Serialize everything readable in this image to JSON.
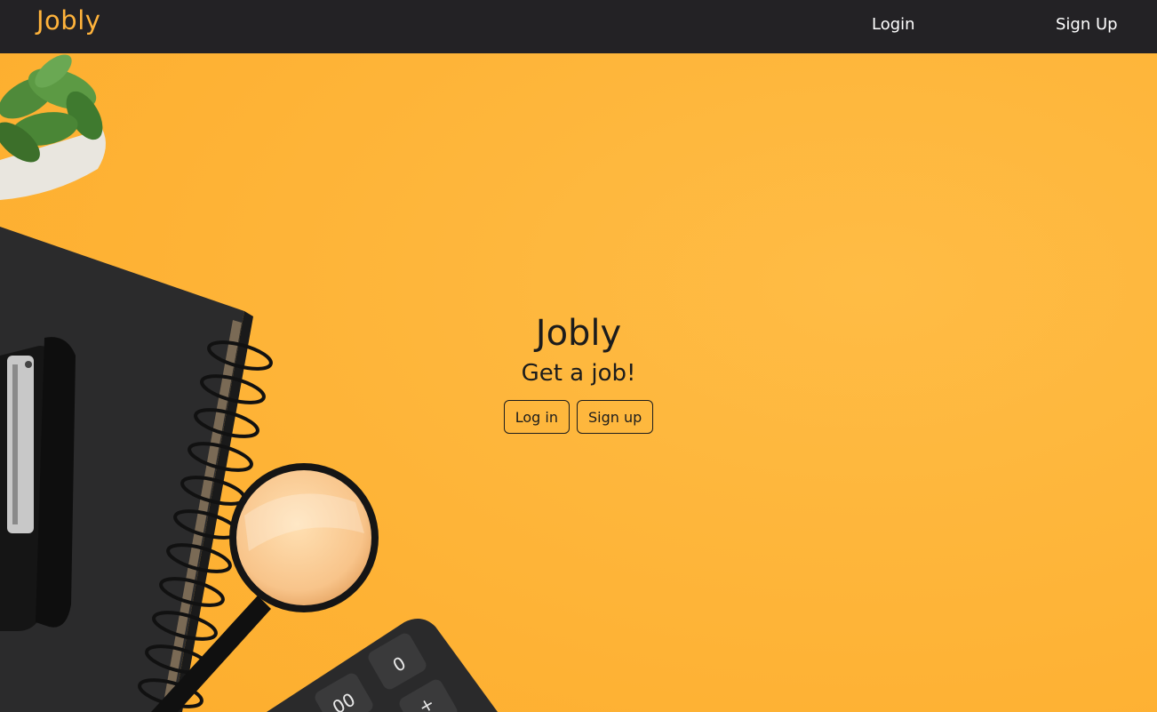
{
  "navbar": {
    "brand": "Jobly",
    "links": {
      "login": "Login",
      "signup": "Sign Up"
    }
  },
  "hero": {
    "title": "Jobly",
    "subtitle": "Get a job!",
    "buttons": {
      "login": "Log in",
      "signup": "Sign up"
    }
  },
  "colors": {
    "accent": "#ffb33b",
    "navbar_bg": "#232225",
    "text_dark": "#1c1c1c"
  },
  "background_image": {
    "items": [
      "succulent-plant-icon",
      "notebook-icon",
      "stapler-icon",
      "magnifying-glass-icon",
      "calculator-icon"
    ],
    "calculator_keys": [
      "0",
      "00",
      "+"
    ]
  }
}
